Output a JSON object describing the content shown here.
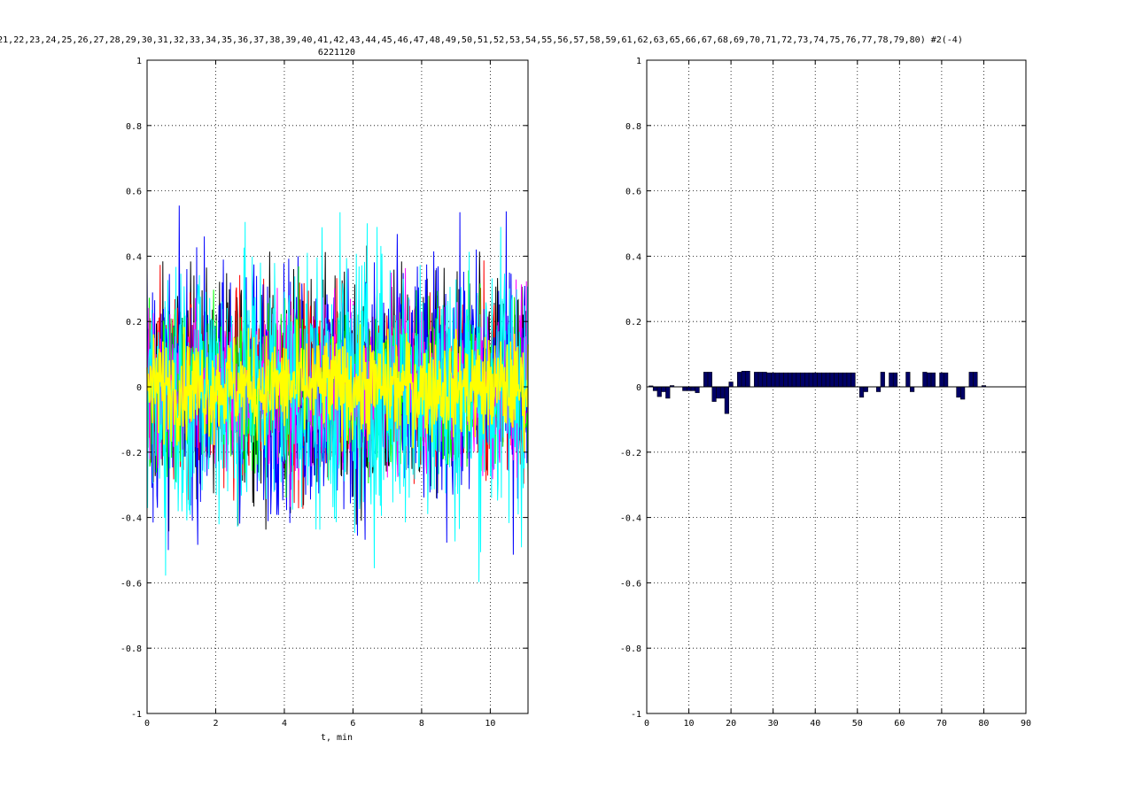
{
  "figure": {
    "title_line1": "21,22,23,24,25,26,27,28,29,30,31,32,33,34,35,36,37,38,39,40,41,42,43,44,45,46,47,48,49,50,51,52,53,54,55,56,57,58,59,61,62,63,65,66,67,68,69,70,71,72,73,74,75,76,77,78,79,80) #2(-4)",
    "title_line2": "6221120"
  },
  "chart_data": [
    {
      "type": "line",
      "xlabel": "t, min",
      "ylabel": "",
      "xlim": [
        0,
        11.1
      ],
      "ylim": [
        -1,
        1
      ],
      "xticks": [
        0,
        2,
        4,
        6,
        8,
        10
      ],
      "xtick_labels": [
        "0",
        "2",
        "4",
        "6",
        "8",
        "10"
      ],
      "yticks": [
        -1,
        -0.8,
        -0.6,
        -0.4,
        -0.2,
        0,
        0.2,
        0.4,
        0.6,
        0.8,
        1
      ],
      "ytick_labels": [
        "-1",
        "-0.8",
        "-0.6",
        "-0.4",
        "-0.2",
        "0",
        "0.2",
        "0.4",
        "0.6",
        "0.8",
        "1"
      ],
      "grid": true,
      "series_colors": [
        "#000000",
        "#ff0000",
        "#0000ff",
        "#00ff00",
        "#ff00ff",
        "#00ffff",
        "#ffff00"
      ],
      "series_amplitude": [
        0.62,
        0.55,
        0.7,
        0.5,
        0.45,
        0.8,
        0.28
      ],
      "samples_per_series": 700
    },
    {
      "type": "bar",
      "xlim": [
        0,
        90
      ],
      "ylim": [
        -1,
        1
      ],
      "xticks": [
        0,
        10,
        20,
        30,
        40,
        50,
        60,
        70,
        80,
        90
      ],
      "xtick_labels": [
        "0",
        "10",
        "20",
        "30",
        "40",
        "50",
        "60",
        "70",
        "80",
        "90"
      ],
      "yticks": [
        -1,
        -0.8,
        -0.6,
        -0.4,
        -0.2,
        0,
        0.2,
        0.4,
        0.6,
        0.8,
        1
      ],
      "ytick_labels": [
        "-1",
        "-0.8",
        "-0.6",
        "-0.4",
        "-0.2",
        "0",
        "0.2",
        "0.4",
        "0.6",
        "0.8",
        "1"
      ],
      "grid": true,
      "bar_color": "#000066",
      "categories": [
        1,
        2,
        3,
        4,
        5,
        6,
        7,
        8,
        9,
        10,
        11,
        12,
        13,
        14,
        15,
        16,
        17,
        18,
        19,
        20,
        21,
        22,
        23,
        24,
        25,
        26,
        27,
        28,
        29,
        30,
        31,
        32,
        33,
        34,
        35,
        36,
        37,
        38,
        39,
        40,
        41,
        42,
        43,
        44,
        45,
        46,
        47,
        48,
        49,
        50,
        51,
        52,
        53,
        54,
        55,
        56,
        57,
        58,
        59,
        60,
        61,
        62,
        63,
        64,
        65,
        66,
        67,
        68,
        69,
        70,
        71,
        72,
        73,
        74,
        75,
        76,
        77,
        78,
        79,
        80
      ],
      "values": [
        0.003,
        -0.012,
        -0.03,
        -0.015,
        -0.035,
        0.004,
        0.0,
        0.0,
        -0.012,
        -0.012,
        -0.012,
        -0.018,
        0.0,
        0.045,
        0.045,
        -0.045,
        -0.035,
        -0.035,
        -0.082,
        0.015,
        0.0,
        0.045,
        0.048,
        0.048,
        0.0,
        0.045,
        0.045,
        0.045,
        0.043,
        0.043,
        0.043,
        0.043,
        0.043,
        0.043,
        0.043,
        0.043,
        0.043,
        0.043,
        0.043,
        0.043,
        0.043,
        0.043,
        0.043,
        0.043,
        0.043,
        0.043,
        0.043,
        0.043,
        0.043,
        0.0,
        -0.032,
        -0.015,
        0.0,
        0.0,
        -0.015,
        0.045,
        0.0,
        0.043,
        0.043,
        0.0,
        0.0,
        0.045,
        -0.015,
        0.0,
        0.0,
        0.045,
        0.043,
        0.043,
        0.0,
        0.043,
        0.043,
        0.0,
        0.0,
        -0.032,
        -0.038,
        0.0,
        0.045,
        0.045,
        0.0,
        0.004
      ]
    }
  ]
}
